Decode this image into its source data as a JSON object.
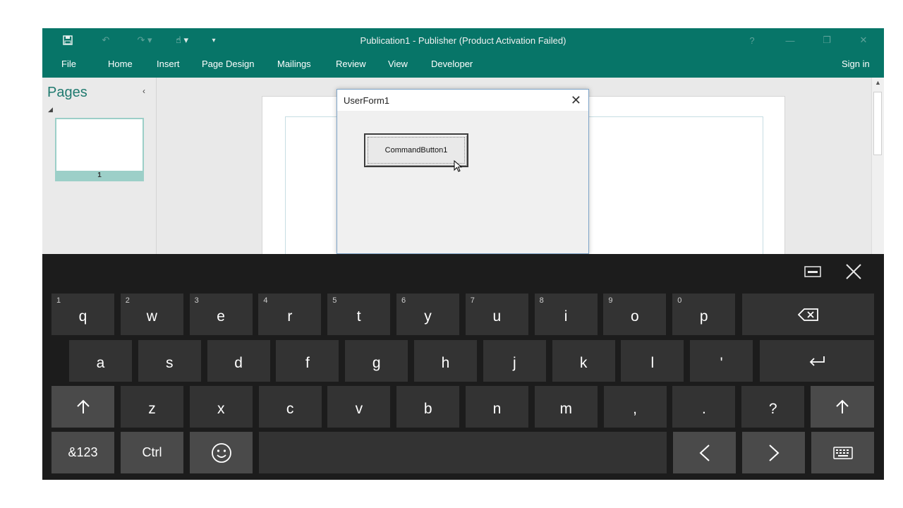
{
  "window": {
    "title": "Publication1 - Publisher (Product Activation Failed)",
    "sign_in": "Sign in",
    "help": "?"
  },
  "ribbon": {
    "tabs": [
      "File",
      "Home",
      "Insert",
      "Page Design",
      "Mailings",
      "Review",
      "View",
      "Developer"
    ]
  },
  "pages_pane": {
    "title": "Pages",
    "collapse_glyph": "‹",
    "thumbnail_number": "1"
  },
  "userform": {
    "title": "UserForm1",
    "close_glyph": "✕",
    "button_label": "CommandButton1"
  },
  "keyboard": {
    "row1": [
      {
        "key": "q",
        "hint": "1"
      },
      {
        "key": "w",
        "hint": "2"
      },
      {
        "key": "e",
        "hint": "3"
      },
      {
        "key": "r",
        "hint": "4"
      },
      {
        "key": "t",
        "hint": "5"
      },
      {
        "key": "y",
        "hint": "6"
      },
      {
        "key": "u",
        "hint": "7"
      },
      {
        "key": "i",
        "hint": "8"
      },
      {
        "key": "o",
        "hint": "9"
      },
      {
        "key": "p",
        "hint": "0"
      }
    ],
    "row2": [
      "a",
      "s",
      "d",
      "f",
      "g",
      "h",
      "j",
      "k",
      "l",
      "'"
    ],
    "row3": [
      "z",
      "x",
      "c",
      "v",
      "b",
      "n",
      "m",
      ",",
      ".",
      "?"
    ],
    "numbers_label": "&123",
    "ctrl_label": "Ctrl",
    "icons": {
      "backspace": "backspace-icon",
      "enter": "enter-icon",
      "shift": "shift-icon",
      "emoji": "emoji-icon",
      "left": "left-arrow-icon",
      "right": "right-arrow-icon",
      "keyboard": "keyboard-icon",
      "dock": "dock-icon",
      "close": "close-icon"
    }
  },
  "colors": {
    "ribbon": "#077568",
    "accent_light": "#9ccfc8",
    "keyboard_bg": "#1c1c1c",
    "key_bg": "#333333"
  }
}
